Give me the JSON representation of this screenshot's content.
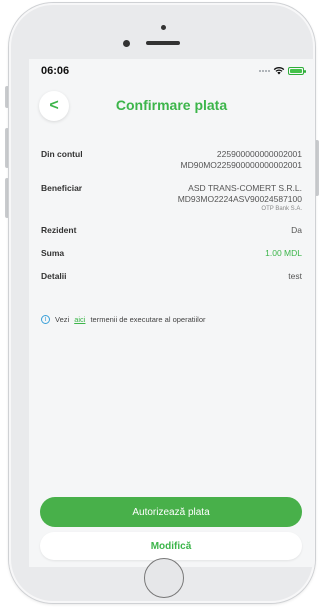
{
  "status_bar": {
    "time": "06:06"
  },
  "header": {
    "title": "Confirmare plata",
    "back_glyph": "<"
  },
  "details": [
    {
      "label": "Din contul",
      "lines": [
        "225900000000002001",
        "MD90MO225900000000002001"
      ]
    },
    {
      "label": "Beneficiar",
      "lines": [
        "ASD TRANS-COMERT S.R.L.",
        "MD93MO2224ASV90024587100"
      ],
      "sub": "OTP Bank S.A."
    },
    {
      "label": "Rezident",
      "lines": [
        "Da"
      ]
    },
    {
      "label": "Suma",
      "lines": [
        "1.00 MDL"
      ],
      "highlight": true
    },
    {
      "label": "Detalii",
      "lines": [
        "test"
      ]
    }
  ],
  "info": {
    "prefix": "Vezi",
    "link": "aici",
    "suffix": "termenii de executare al operatiilor"
  },
  "buttons": {
    "authorize": "Autorizează plata",
    "modify": "Modifică"
  },
  "colors": {
    "accent": "#3cb54a",
    "button_green": "#48b04a",
    "info_blue": "#3aa0d8"
  }
}
